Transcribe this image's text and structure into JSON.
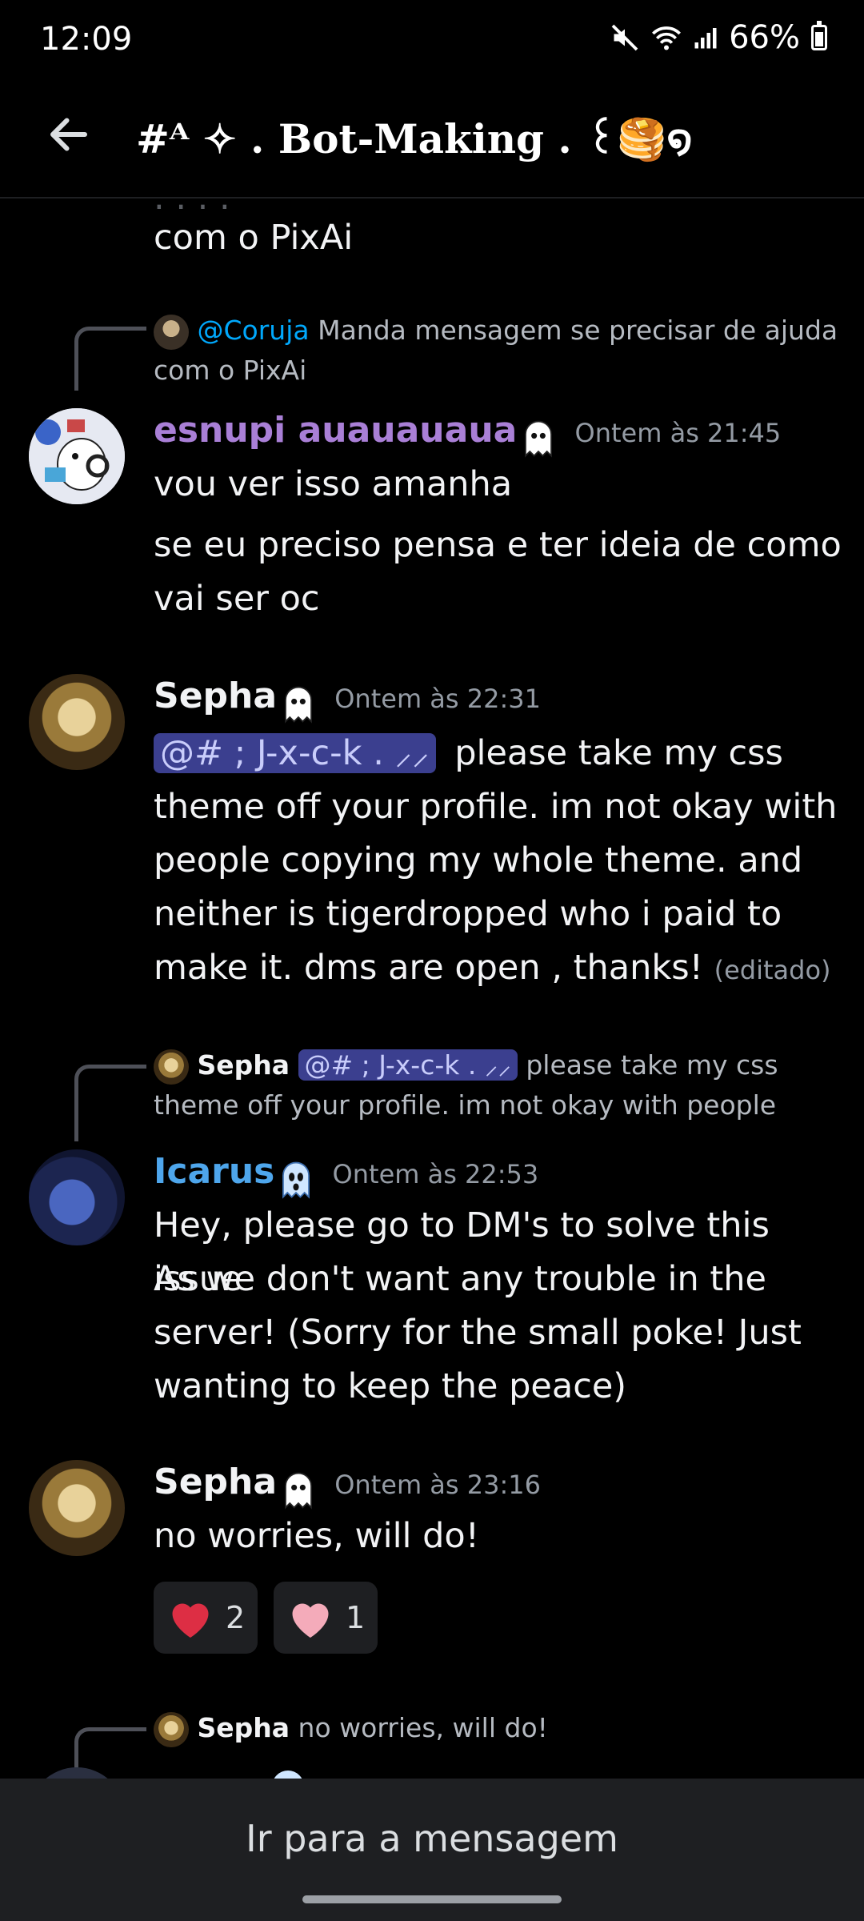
{
  "status_bar": {
    "time": "12:09",
    "battery": "66%"
  },
  "header": {
    "back_icon": "arrow-left-icon",
    "channel_name": "#ᴬ ✧ . Bot-Making . ꒰🥞໑"
  },
  "messages": [
    {
      "id": "partial",
      "text": "com o PixAi"
    },
    {
      "id": "m1",
      "reply": {
        "author": "@Coruja",
        "text_line1": "Manda mensagem se precisar de ajuda",
        "text_line2": "com o PixAi"
      },
      "author": "esnupi auauauaua",
      "author_color": "#a97fd6",
      "timestamp": "Ontem às 21:45",
      "lines": [
        "vou ver isso amanha",
        "se eu preciso pensa e ter ideia de como",
        "vai ser oc"
      ]
    },
    {
      "id": "m2",
      "author": "Sepha",
      "author_color": "#f2f3f5",
      "timestamp": "Ontem às 22:31",
      "mention": "@# ; J-x-c-k . ⸝⸝",
      "line1_rest": "please take my css",
      "lines": [
        "theme off your profile. im not okay with",
        "people copying my whole theme. and",
        "neither is tigerdropped who i paid to",
        "make it. dms are open , thanks!"
      ],
      "edited": "(editado)"
    },
    {
      "id": "m3",
      "reply": {
        "author": "Sepha",
        "mention": "@# ; J-x-c-k . ⸝⸝",
        "text_line1": "please take my css",
        "text_line2": "theme off your profile. im not okay with people"
      },
      "author": "Icarus",
      "author_color": "#4ea6ec",
      "timestamp": "Ontem às 22:53",
      "lines": [
        "Hey, please go to DM's to solve this issue",
        "As we don't want any trouble in the",
        "server! (Sorry for the small poke! Just",
        "wanting to keep the peace)"
      ]
    },
    {
      "id": "m4",
      "author": "Sepha",
      "author_color": "#f2f3f5",
      "timestamp": "Ontem às 23:16",
      "lines": [
        "no worries, will do!"
      ],
      "reactions": [
        {
          "emoji": "red-heart-icon",
          "count": "2"
        },
        {
          "emoji": "pink-heart-icon",
          "count": "1"
        }
      ]
    },
    {
      "id": "m5",
      "reply": {
        "author": "Sepha",
        "text_line1": "no worries, will do!"
      }
    }
  ],
  "jump_bar": {
    "label": "Ir para a mensagem"
  }
}
